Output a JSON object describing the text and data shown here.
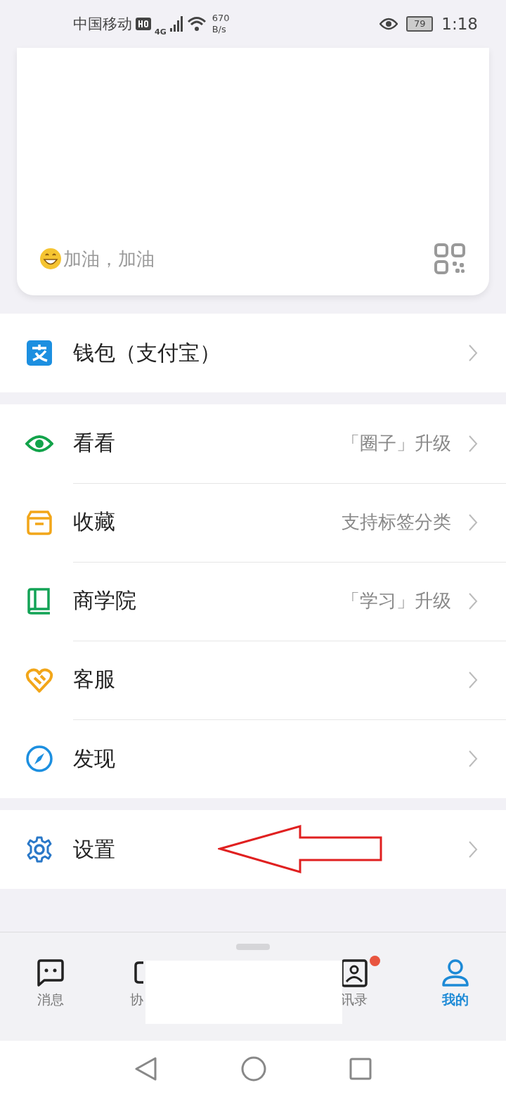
{
  "status_bar": {
    "carrier": "中国移动",
    "network": "4G",
    "speed_value": "670",
    "speed_unit": "B/s",
    "battery": "79",
    "time": "1:18"
  },
  "profile_card": {
    "signature": "加油，加油"
  },
  "menu_groups": [
    {
      "items": [
        {
          "label": "钱包（支付宝）"
        }
      ]
    },
    {
      "items": [
        {
          "label": "看看",
          "hint": "「圈子」升级"
        },
        {
          "label": "收藏",
          "hint": "支持标签分类"
        },
        {
          "label": "商学院",
          "hint": "「学习」升级"
        },
        {
          "label": "客服"
        },
        {
          "label": "发现"
        }
      ]
    },
    {
      "items": [
        {
          "label": "设置"
        }
      ]
    }
  ],
  "bottom_nav": [
    {
      "label": "消息",
      "selected": false,
      "badge": false
    },
    {
      "label": "协",
      "selected": false,
      "badge": false
    },
    {
      "label": "讯录",
      "selected": false,
      "badge": true
    },
    {
      "label": "我的",
      "selected": true,
      "badge": false
    }
  ]
}
